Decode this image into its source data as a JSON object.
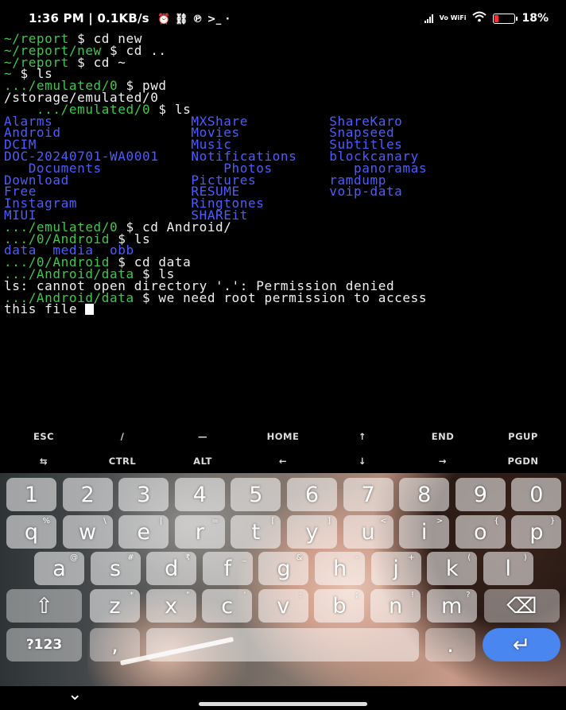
{
  "status": {
    "time_info": "1:36 PM | 0.1KB/s",
    "left_icons": [
      "alarm-icon",
      "vpn-icon",
      "nfc-icon",
      "terminal-icon",
      "dot-icon"
    ],
    "network": "Vo WiFi",
    "battery": "18%"
  },
  "terminal": {
    "lines": [
      [
        {
          "t": "~/report",
          "c": "g"
        },
        {
          "t": " $ cd new",
          "c": "w"
        }
      ],
      [
        {
          "t": "~/report/new",
          "c": "g"
        },
        {
          "t": " $ cd ..",
          "c": "w"
        }
      ],
      [
        {
          "t": "~/report",
          "c": "g"
        },
        {
          "t": " $ cd ~",
          "c": "w"
        }
      ],
      [
        {
          "t": "~",
          "c": "g"
        },
        {
          "t": " $ ls",
          "c": "w"
        }
      ],
      [
        {
          "t": ".../emulated/0",
          "c": "g"
        },
        {
          "t": " $ pwd",
          "c": "w"
        }
      ],
      [
        {
          "t": "/storage/emulated/0",
          "c": "w"
        }
      ],
      [
        {
          "t": "    .../emulated/0",
          "c": "g"
        },
        {
          "t": " $ ls",
          "c": "w"
        }
      ],
      [
        {
          "t": "Alarms                 MXShare          ShareKaro",
          "c": "b"
        }
      ],
      [
        {
          "t": "Android                Movies           Snapseed",
          "c": "b"
        }
      ],
      [
        {
          "t": "DCIM                   Music            Subtitles",
          "c": "b"
        }
      ],
      [
        {
          "t": "DOC-20240701-WA0001    Notifications    blockcanary",
          "c": "b"
        }
      ],
      [
        {
          "t": "   Documents               Photos          panoramas",
          "c": "b"
        }
      ],
      [
        {
          "t": "Download               Pictures         ramdump",
          "c": "b"
        }
      ],
      [
        {
          "t": "Free                   RESUME           voip-data",
          "c": "b"
        }
      ],
      [
        {
          "t": "Instagram              Ringtones",
          "c": "b"
        }
      ],
      [
        {
          "t": "MIUI                   SHAREit",
          "c": "b"
        }
      ],
      [
        {
          "t": ".../emulated/0",
          "c": "g"
        },
        {
          "t": " $ cd Android/",
          "c": "w"
        }
      ],
      [
        {
          "t": ".../0/Android",
          "c": "g"
        },
        {
          "t": " $ ls",
          "c": "w"
        }
      ],
      [
        {
          "t": "data  media  obb",
          "c": "b"
        }
      ],
      [
        {
          "t": ".../0/Android",
          "c": "g"
        },
        {
          "t": " $ cd data",
          "c": "w"
        }
      ],
      [
        {
          "t": ".../Android/data",
          "c": "g"
        },
        {
          "t": " $ ls",
          "c": "w"
        }
      ],
      [
        {
          "t": "ls: cannot open directory '.': Permission denied",
          "c": "w"
        }
      ],
      [
        {
          "t": ".../Android/data",
          "c": "g"
        },
        {
          "t": " $ we need root permission to access",
          "c": "w"
        }
      ],
      [
        {
          "t": "this file ",
          "c": "w"
        }
      ]
    ]
  },
  "extra_keys": {
    "row1": [
      "ESC",
      "/",
      "—",
      "HOME",
      "↑",
      "END",
      "PGUP"
    ],
    "row2": [
      "⇆",
      "CTRL",
      "ALT",
      "←",
      "↓",
      "→",
      "PGDN"
    ]
  },
  "keyboard": {
    "numbers": [
      "1",
      "2",
      "3",
      "4",
      "5",
      "6",
      "7",
      "8",
      "9",
      "0"
    ],
    "row1": [
      "q",
      "w",
      "e",
      "r",
      "t",
      "y",
      "u",
      "i",
      "o",
      "p"
    ],
    "row1_hints": [
      "%",
      "\\",
      "|",
      "=",
      "[",
      "]",
      "<",
      ">",
      "{",
      "}"
    ],
    "row2": [
      "a",
      "s",
      "d",
      "f",
      "g",
      "h",
      "j",
      "k",
      "l"
    ],
    "row2_hints": [
      "@",
      "#",
      "₹",
      "_",
      "&",
      "-",
      "+",
      "(",
      ")"
    ],
    "row3": [
      "z",
      "x",
      "c",
      "v",
      "b",
      "n",
      "m"
    ],
    "row3_hints": [
      "*",
      "\"",
      "'",
      ":",
      ";",
      "!",
      "?"
    ],
    "sym_label": "?123",
    "comma_label": ",",
    "period_label": ".",
    "enter_glyph": "↵",
    "backspace_glyph": "⌫",
    "shift_glyph": "⇧"
  },
  "colors": {
    "prompt": "#3cc84a",
    "directory": "#4d5cff",
    "enter_key": "#4a86f0",
    "battery_low": "#ff2d2d"
  }
}
